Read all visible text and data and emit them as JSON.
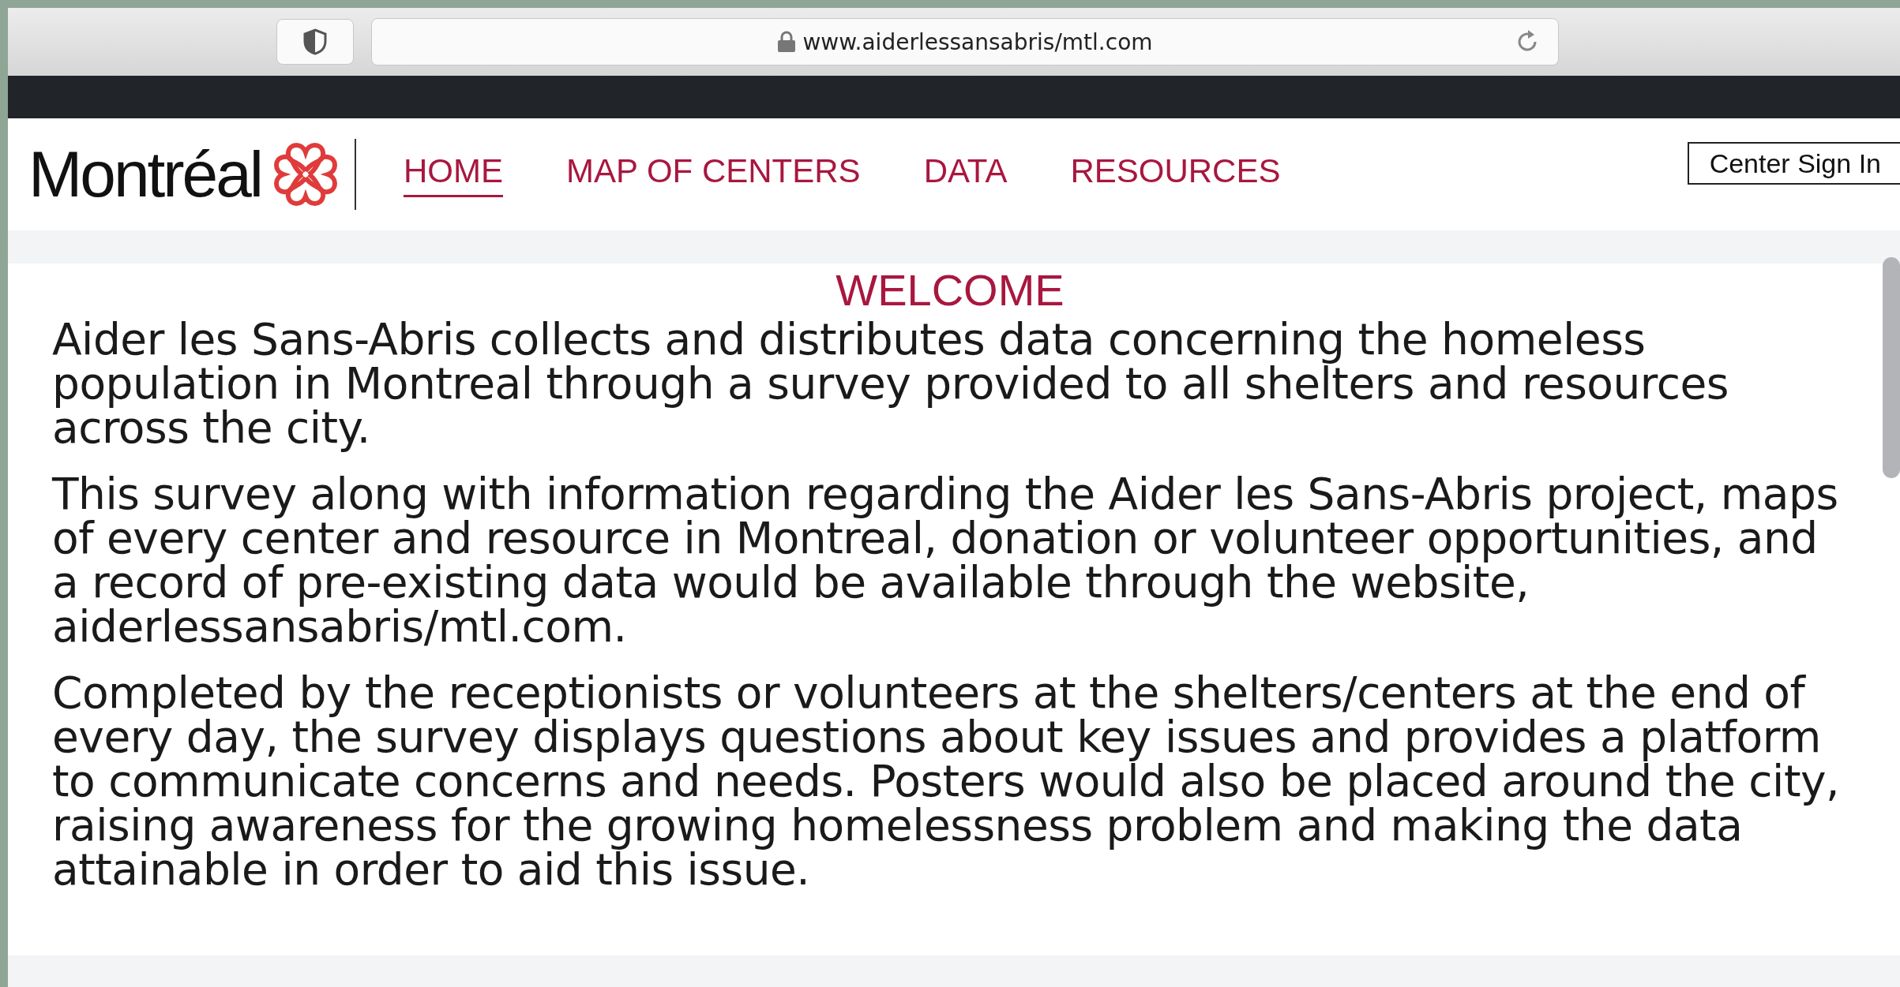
{
  "browser": {
    "url": "www.aiderlessansabris/mtl.com"
  },
  "header": {
    "logo": "Montréal",
    "nav": [
      {
        "label": "HOME",
        "selected": true
      },
      {
        "label": "MAP OF CENTERS",
        "selected": false
      },
      {
        "label": "DATA",
        "selected": false
      },
      {
        "label": "RESOURCES",
        "selected": false
      }
    ],
    "sign_in": "Center Sign In"
  },
  "content": {
    "title": "WELCOME",
    "paragraphs": [
      "Aider les Sans-Abris collects and distributes data concerning the homeless population in Montreal through a survey provided to all shelters and resources across the city.",
      "This survey along with information regarding the Aider les Sans-Abris project, maps of every center and resource in Montreal, donation or volunteer opportunities, and a record of pre-existing data would be available through the website, aiderlessansabris/mtl.com.",
      "Completed by the receptionists or volunteers at the shelters/centers at the end of every day, the survey displays questions about key issues and provides a platform to communicate concerns and needs. Posters would also be placed around the city, raising awareness for the growing homelessness problem and making the data attainable in order to aid this issue."
    ]
  }
}
